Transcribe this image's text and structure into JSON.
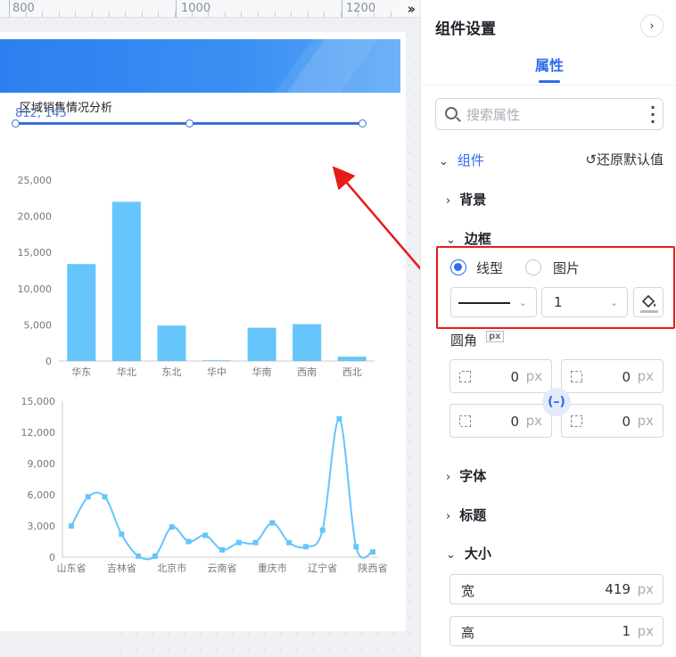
{
  "ruler": {
    "labels": [
      "800",
      "1000",
      "1200"
    ],
    "collapse_icon": "double-chevron-right-icon"
  },
  "canvas": {
    "component_title": "区域销售情况分析",
    "component_coords": "812, 145"
  },
  "chart_data": [
    {
      "type": "bar",
      "categories": [
        "华东",
        "华北",
        "东北",
        "华中",
        "华南",
        "西南",
        "西北"
      ],
      "values": [
        13400,
        22000,
        4900,
        100,
        4600,
        5100,
        600
      ],
      "ylim": [
        0,
        25000
      ],
      "yticks": [
        "0",
        "5,000",
        "10,000",
        "15,000",
        "20,000",
        "25,000"
      ],
      "color": "#66c5fb"
    },
    {
      "type": "line",
      "x": [
        "山东省",
        "",
        "吉林省",
        "",
        "北京市",
        "",
        "云南省",
        "",
        "重庆市",
        "",
        "辽宁省",
        "",
        "陕西省"
      ],
      "xtick_labels": [
        "山东省",
        "吉林省",
        "北京市",
        "云南省",
        "重庆市",
        "辽宁省",
        "陕西省"
      ],
      "values": [
        3000,
        5800,
        5800,
        2200,
        100,
        100,
        2900,
        1500,
        2100,
        700,
        1400,
        1400,
        3300,
        1400,
        1000,
        2600,
        13300,
        1000,
        500
      ],
      "ylim": [
        0,
        15000
      ],
      "yticks": [
        "0",
        "3,000",
        "6,000",
        "9,000",
        "12,000",
        "15,000"
      ],
      "color": "#66c5fb"
    }
  ],
  "panel": {
    "title": "组件设置",
    "close_icon": "chevron-right-icon",
    "tab": "属性",
    "search_placeholder": "搜索属性",
    "group_label": "组件",
    "reset_label": "还原默认值",
    "sections": {
      "background": "背景",
      "border": "边框",
      "font": "字体",
      "title": "标题",
      "size": "大小"
    },
    "border": {
      "type_line": "线型",
      "type_image": "图片",
      "selected": "线型",
      "width": "1"
    },
    "radius": {
      "label": "圆角",
      "badge": "px",
      "values": [
        "0",
        "0",
        "0",
        "0"
      ],
      "unit": "px"
    },
    "size": {
      "width_label": "宽",
      "width_value": "419",
      "height_label": "高",
      "height_value": "1",
      "unit": "px"
    }
  },
  "colors": {
    "accent": "#2f6bef",
    "highlight": "#e81a1a",
    "chart": "#66c5fb"
  }
}
